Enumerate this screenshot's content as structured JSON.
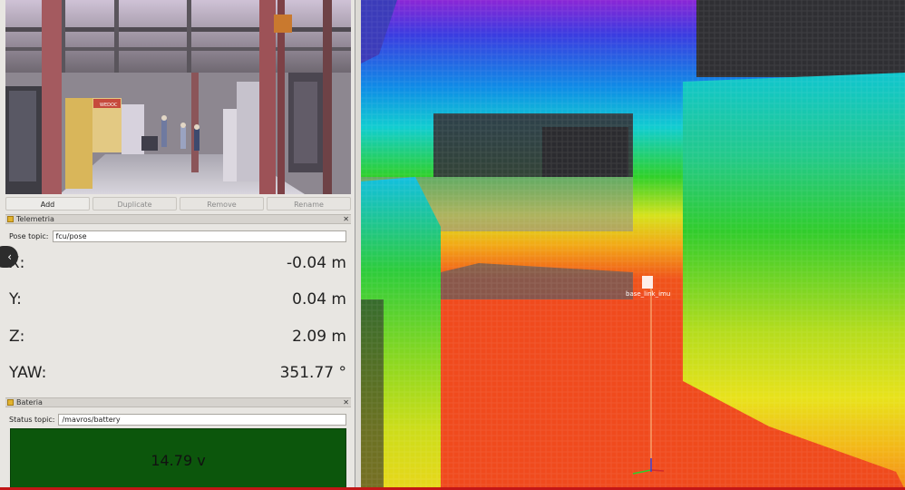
{
  "toolbar": {
    "add_label": "Add",
    "duplicate_label": "Duplicate",
    "remove_label": "Remove",
    "rename_label": "Rename"
  },
  "camera": {
    "sign_text": "WEDOC"
  },
  "telemetria": {
    "title": "Telemetria",
    "close_icon": "close-icon",
    "topic_label": "Pose topic:",
    "topic_value": "fcu/pose",
    "rows": [
      {
        "label": "X:",
        "value": "-0.04 m"
      },
      {
        "label": "Y:",
        "value": "0.04 m"
      },
      {
        "label": "Z:",
        "value": "2.09 m"
      },
      {
        "label": "YAW:",
        "value": "351.77 °"
      }
    ]
  },
  "bateria": {
    "title": "Bateria",
    "topic_label": "Status topic:",
    "topic_value": "/mavros/battery",
    "value": "14.79 v",
    "status_color": "#0c560c"
  },
  "view3d": {
    "frame_label": "base_link_imu"
  }
}
